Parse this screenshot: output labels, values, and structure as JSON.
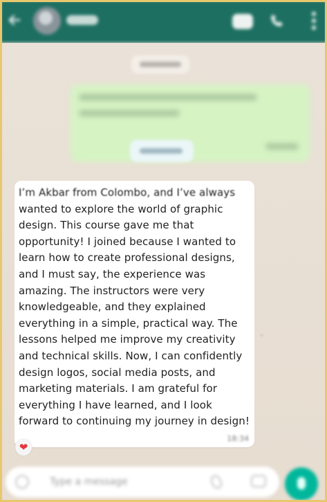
{
  "topbar": {
    "contact_name": "",
    "icons": {
      "back": "arrow-left-icon",
      "avatar": "avatar",
      "video": "video-call-icon",
      "call": "phone-icon",
      "menu": "more-vertical-icon"
    }
  },
  "chat": {
    "date_chip": "",
    "sent_message": {
      "text": ""
    },
    "unread_chip": "",
    "received_message": {
      "lines": [
        "I’m Akbar from Colombo, and I’ve always",
        "wanted to explore the world of graphic",
        "design. This course gave me that",
        "opportunity! I joined because I wanted to",
        "learn how to create professional designs,",
        "and I must say, the experience was",
        "amazing. The instructors were very",
        "knowledgeable, and they explained",
        "everything in a simple, practical way. The",
        "lessons helped me improve my creativity",
        "and technical skills. Now, I can confidently",
        "design logos, social media posts, and",
        "marketing materials. I am grateful for",
        "everything I have learned, and I look",
        "forward to continuing my journey in design!"
      ],
      "timestamp": "18:34",
      "reaction": "❤"
    }
  },
  "composer": {
    "placeholder": "Type a message",
    "icons": {
      "emoji": "emoji-icon",
      "attach": "paperclip-icon",
      "camera": "camera-icon",
      "send": "mic-icon"
    }
  },
  "colors": {
    "header": "#1d6f61",
    "chat_background": "#e7ddd1",
    "received_bubble": "#ffffff",
    "sent_bubble": "#d6f3c4",
    "send_button": "#00b79c",
    "reaction_heart": "#e3383d",
    "page_border": "#e8c76d"
  }
}
